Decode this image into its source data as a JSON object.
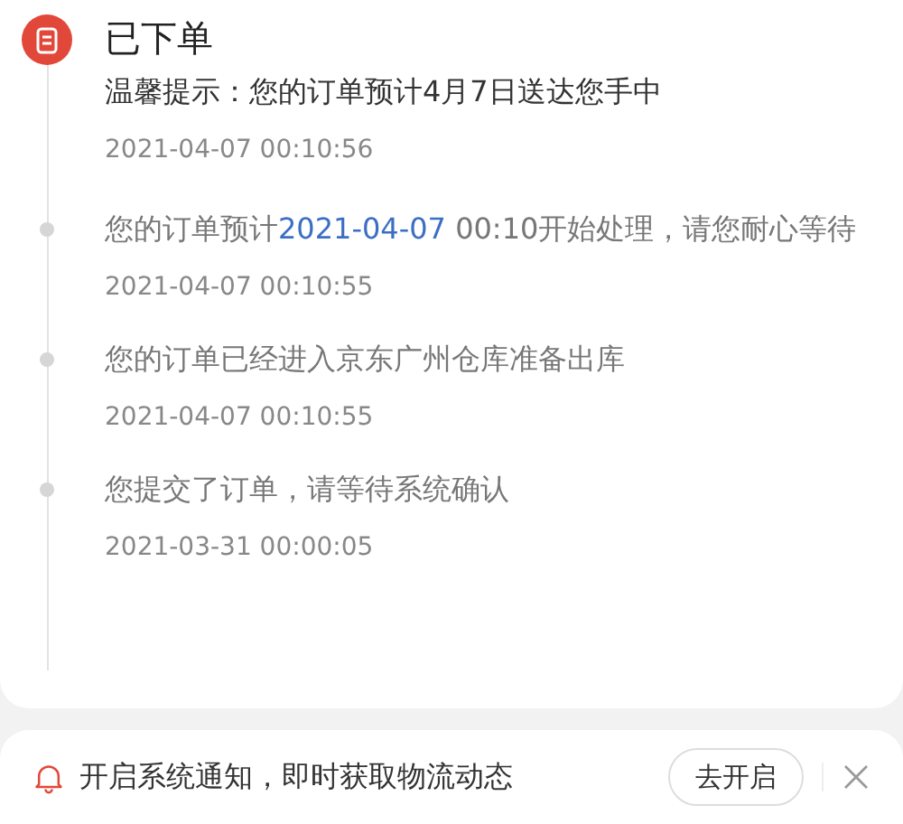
{
  "timeline": [
    {
      "active": true,
      "title": "已下单",
      "text": [
        {
          "kind": "plain",
          "text": "温馨提示：您的订单预计4月7日送达您手中"
        }
      ],
      "time": "2021-04-07 00:10:56"
    },
    {
      "active": false,
      "text": [
        {
          "kind": "plain",
          "text": "您的订单预计"
        },
        {
          "kind": "highlight",
          "text": "2021-04-07"
        },
        {
          "kind": "plain",
          "text": " 00:10开始处理，请您耐心等待"
        }
      ],
      "time": "2021-04-07 00:10:55"
    },
    {
      "active": false,
      "text": [
        {
          "kind": "plain",
          "text": "您的订单已经进入京东广州仓库准备出库"
        }
      ],
      "time": "2021-04-07 00:10:55"
    },
    {
      "active": false,
      "text": [
        {
          "kind": "plain",
          "text": "您提交了订单，请等待系统确认"
        }
      ],
      "time": "2021-03-31 00:00:05"
    }
  ],
  "notice_bar": {
    "text": "开启系统通知，即时获取物流动态",
    "button": "去开启"
  }
}
